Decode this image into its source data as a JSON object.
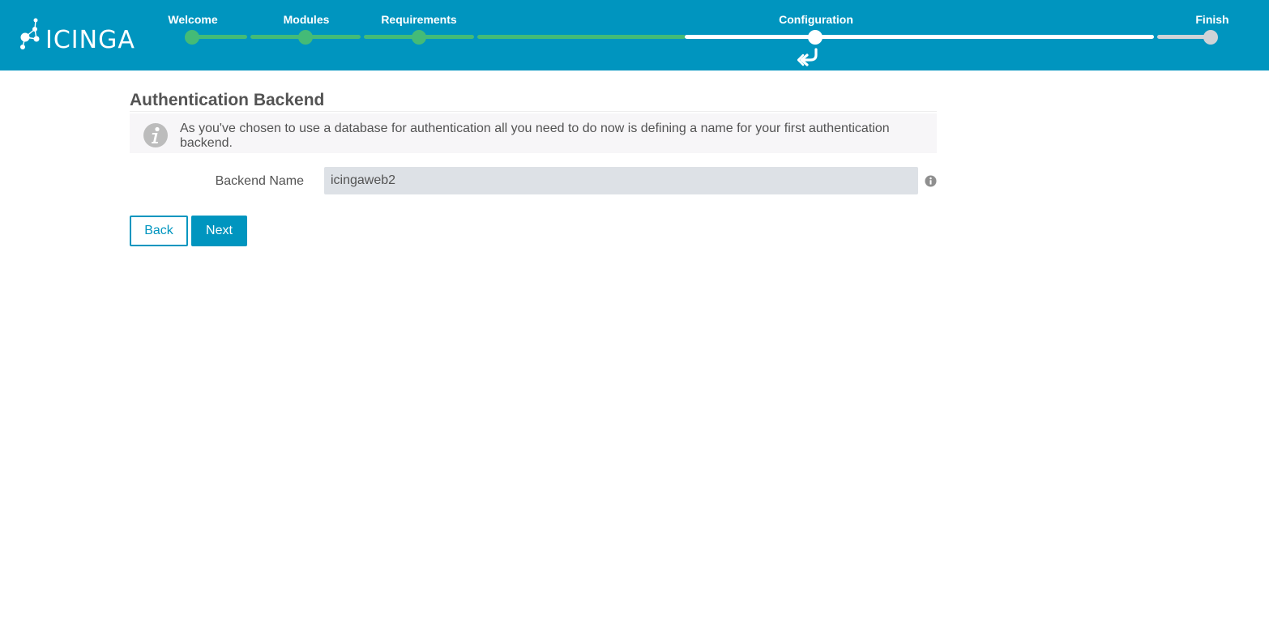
{
  "app": {
    "logo_text": "icinga"
  },
  "wizard": {
    "steps": [
      {
        "label": "Welcome",
        "state": "completed"
      },
      {
        "label": "Modules",
        "state": "completed"
      },
      {
        "label": "Requirements",
        "state": "completed"
      },
      {
        "label": "Configuration",
        "state": "current"
      },
      {
        "label": "Finish",
        "state": "pending"
      }
    ],
    "colors": {
      "header": "#0095bf",
      "completed": "#44bb77",
      "current": "#ffffff",
      "pending": "#cfd3d7"
    }
  },
  "main": {
    "title": "Authentication Backend",
    "info_message": "As you've chosen to use a database for authentication all you need to do now is defining a name for your first authentication backend.",
    "form": {
      "backend_name_label": "Backend Name",
      "backend_name_value": "icingaweb2"
    },
    "buttons": {
      "back_label": "Back",
      "next_label": "Next"
    }
  },
  "icons": {
    "logo": "icinga-logo-icon",
    "back_step": "back-arrow-icon",
    "info": "info-icon",
    "help": "help-info-icon"
  }
}
